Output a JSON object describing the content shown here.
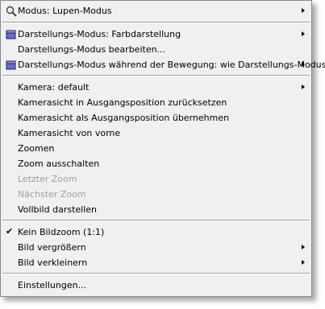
{
  "menu": {
    "items": [
      {
        "label": "Modus:  Lupen-Modus",
        "icon": "magnifier-icon"
      },
      {
        "label": "Darstellungs-Modus: Farbdarstellung",
        "icon": "cube-icon"
      },
      {
        "label": "Darstellungs-Modus bearbeiten..."
      },
      {
        "label": "Darstellungs-Modus während der Bewegung: wie Darstellungs-Modus",
        "icon": "cube-icon"
      },
      {
        "label": "Kamera: default"
      },
      {
        "label": "Kamerasicht in Ausgangsposition zurücksetzen"
      },
      {
        "label": "Kamerasicht als Ausgangsposition übernehmen"
      },
      {
        "label": "Kamerasicht von vorne"
      },
      {
        "label": "Zoomen"
      },
      {
        "label": "Zoom ausschalten"
      },
      {
        "label": "Letzter Zoom",
        "disabled": true
      },
      {
        "label": "Nächster Zoom",
        "disabled": true
      },
      {
        "label": "Vollbild darstellen"
      },
      {
        "label": "Kein Bildzoom (1:1)",
        "checked": true,
        "check_glyph": "✔"
      },
      {
        "label": "Bild vergrößern"
      },
      {
        "label": "Bild verkleinern"
      },
      {
        "label": "Einstellungen..."
      }
    ]
  },
  "colors": {
    "menu_bg": "#f0f0f0",
    "disabled_text": "#a0a0a0",
    "icon_blue": "#6060d0"
  }
}
